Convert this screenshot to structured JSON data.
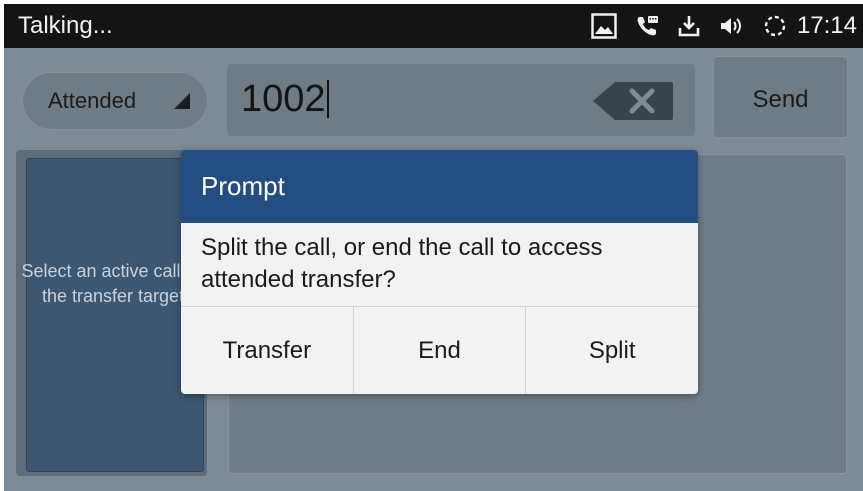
{
  "status_bar": {
    "title": "Talking...",
    "time": "17:14",
    "icons": [
      "image-icon",
      "voicemail-phone-icon",
      "download-icon",
      "volume-icon",
      "sync-icon"
    ]
  },
  "transfer_mode": {
    "selected": "Attended"
  },
  "number_input": {
    "value": "1002"
  },
  "send_button": {
    "label": "Send"
  },
  "target_panel": {
    "hint": "Select an active call as the transfer target"
  },
  "dialog": {
    "title": "Prompt",
    "message": "Split the call, or end the call to access attended transfer?",
    "buttons": {
      "transfer": "Transfer",
      "end": "End",
      "split": "Split"
    }
  },
  "colors": {
    "status_bar_bg": "#141414",
    "dialog_header": "#244d82",
    "dim_overlay_bg": "#7e8a96",
    "selected_card": "#3d5771"
  }
}
